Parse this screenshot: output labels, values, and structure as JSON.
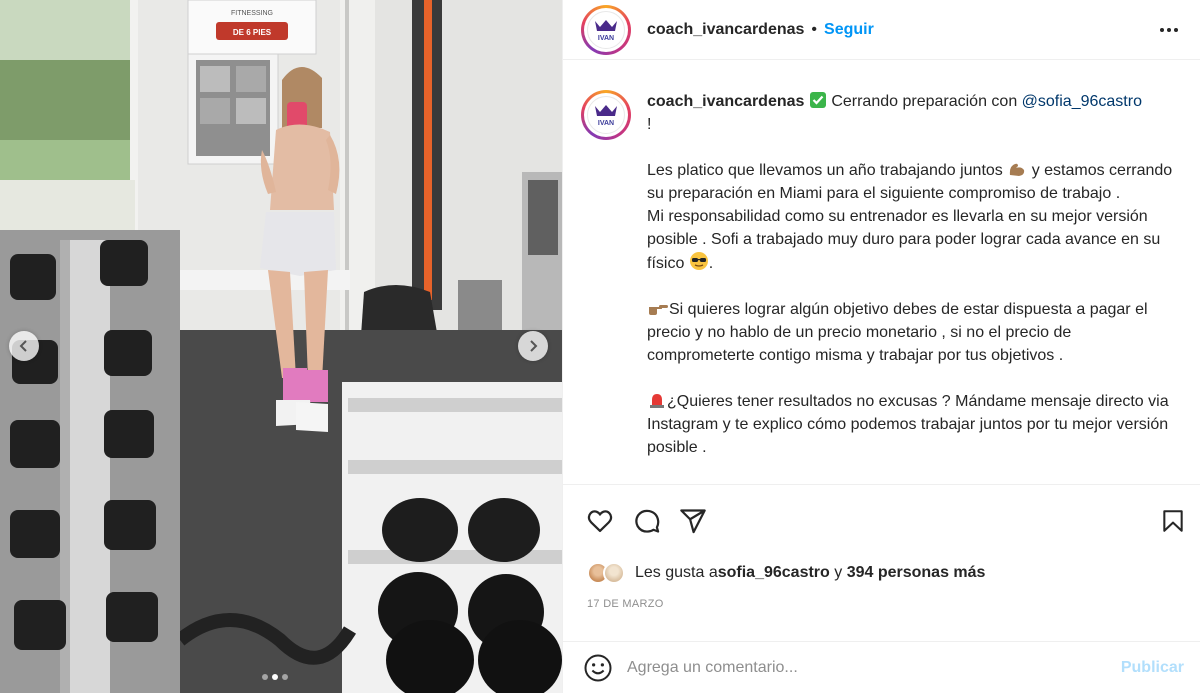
{
  "post": {
    "author": "coach_ivancardenas",
    "separator": "•",
    "follow_label": "Seguir",
    "avatar_text": "IVAN",
    "media": {
      "gym_sign_top": "FITNESSING",
      "gym_sign_bottom": "DE 6 PIES",
      "slide_dots": 3,
      "active_dot": 1
    },
    "caption": {
      "username": "coach_ivancardenas",
      "line1_after_check": " Cerrando preparación con ",
      "mention": "@sofia_96castro",
      "line1_end": "!",
      "p1_a": "Les platico que llevamos un año trabajando juntos ",
      "p1_b": " y estamos cerrando su preparación en Miami para el siguiente compromiso de trabajo .",
      "p2": "Mi responsabilidad como su entrenador es llevarla en su mejor versión posible . Sofi a trabajado muy duro para poder lograr cada avance en su físico ",
      "p2_end": ".",
      "p3": "Si quieres lograr algún objetivo debes de estar dispuesta a pagar el precio y no hablo de un precio monetario , si no el precio de comprometerte contigo misma y trabajar por tus objetivos .",
      "p4": "¿Quieres tener resultados no excusas ? Mándame mensaje directo via Instagram y te explico cómo podemos trabajar juntos por tu mejor versión posible ."
    },
    "likes": {
      "prefix": "Les gusta a ",
      "liker": "sofia_96castro",
      "middle": " y ",
      "others": "394 personas más"
    },
    "date": "17 DE MARZO",
    "comment": {
      "placeholder": "Agrega un comentario...",
      "publish_label": "Publicar"
    },
    "colors": {
      "link_blue": "#0095f6",
      "publish_disabled": "#b2dffc",
      "text": "#262626",
      "muted": "#8e8e8e",
      "mention": "#00376b"
    },
    "icons": [
      "heart-icon",
      "comment-icon",
      "share-icon",
      "bookmark-icon",
      "more-icon",
      "emoji-icon",
      "check-icon",
      "flexed-biceps-icon",
      "sunglasses-face-icon",
      "pointing-hand-icon",
      "siren-icon",
      "chevron-left-icon",
      "chevron-right-icon"
    ]
  }
}
